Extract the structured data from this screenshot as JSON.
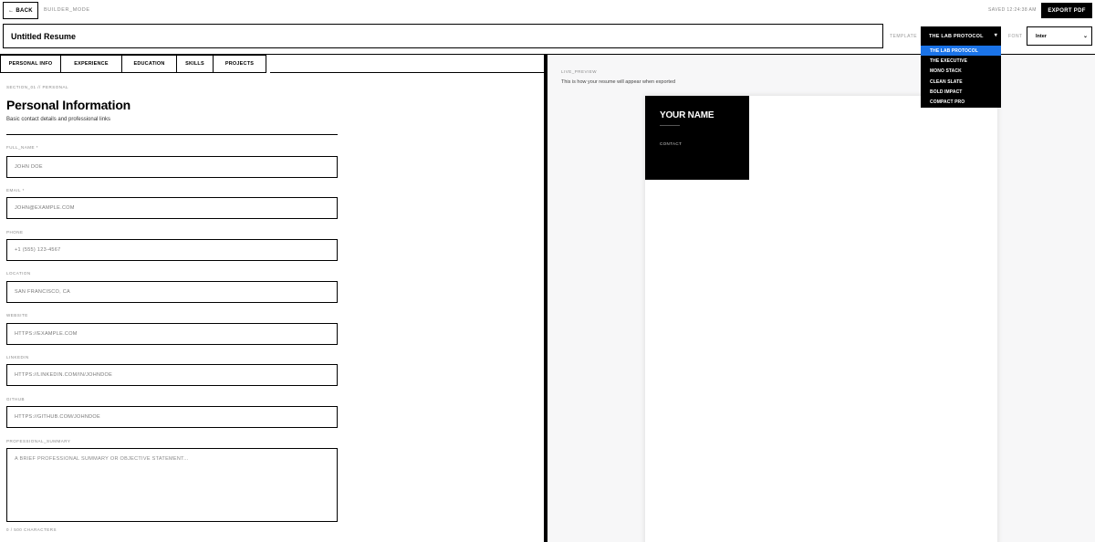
{
  "topbar": {
    "back_label": "← BACK",
    "mode_label": "BUILDER_MODE",
    "saved_text": "SAVED 12:24:38 AM",
    "export_label": "EXPORT PDF"
  },
  "document": {
    "title": "Untitled Resume"
  },
  "template": {
    "label": "TEMPLATE",
    "selected": "THE LAB PROTOCOL",
    "options": [
      "THE LAB PROTOCOL",
      "THE EXECUTIVE",
      "MONO STACK",
      "CLEAN SLATE",
      "BOLD IMPACT",
      "COMPACT PRO"
    ]
  },
  "font": {
    "label": "FONT",
    "selected": "Inter"
  },
  "tabs": [
    "PERSONAL INFO",
    "EXPERIENCE",
    "EDUCATION",
    "SKILLS",
    "PROJECTS"
  ],
  "section": {
    "crumb": "SECTION_01 // PERSONAL",
    "title": "Personal Information",
    "subtitle": "Basic contact details and professional links"
  },
  "fields": {
    "full_name": {
      "label": "FULL_NAME *",
      "placeholder": "JOHN DOE"
    },
    "email": {
      "label": "EMAIL *",
      "placeholder": "JOHN@EXAMPLE.COM"
    },
    "phone": {
      "label": "PHONE",
      "placeholder": "+1 (555) 123-4567"
    },
    "location": {
      "label": "LOCATION",
      "placeholder": "SAN FRANCISCO, CA"
    },
    "website": {
      "label": "WEBSITE",
      "placeholder": "HTTPS://EXAMPLE.COM"
    },
    "linkedin": {
      "label": "LINKEDIN",
      "placeholder": "HTTPS://LINKEDIN.COM/IN/JOHNDOE"
    },
    "github": {
      "label": "GITHUB",
      "placeholder": "HTTPS://GITHUB.COM/JOHNDOE"
    },
    "summary": {
      "label": "PROFESSIONAL_SUMMARY",
      "placeholder": "A BRIEF PROFESSIONAL SUMMARY OR OBJECTIVE STATEMENT..."
    },
    "char_count": "0 / 500 CHARACTERS"
  },
  "preview": {
    "label": "LIVE_PREVIEW",
    "subtitle": "This is how your resume will appear when exported",
    "resume_name": "YOUR NAME",
    "resume_contact": "CONTACT"
  },
  "colors": {
    "accent": "#000000",
    "dropdown_highlight": "#1a73e8",
    "preview_bg": "#f7f7f8"
  }
}
